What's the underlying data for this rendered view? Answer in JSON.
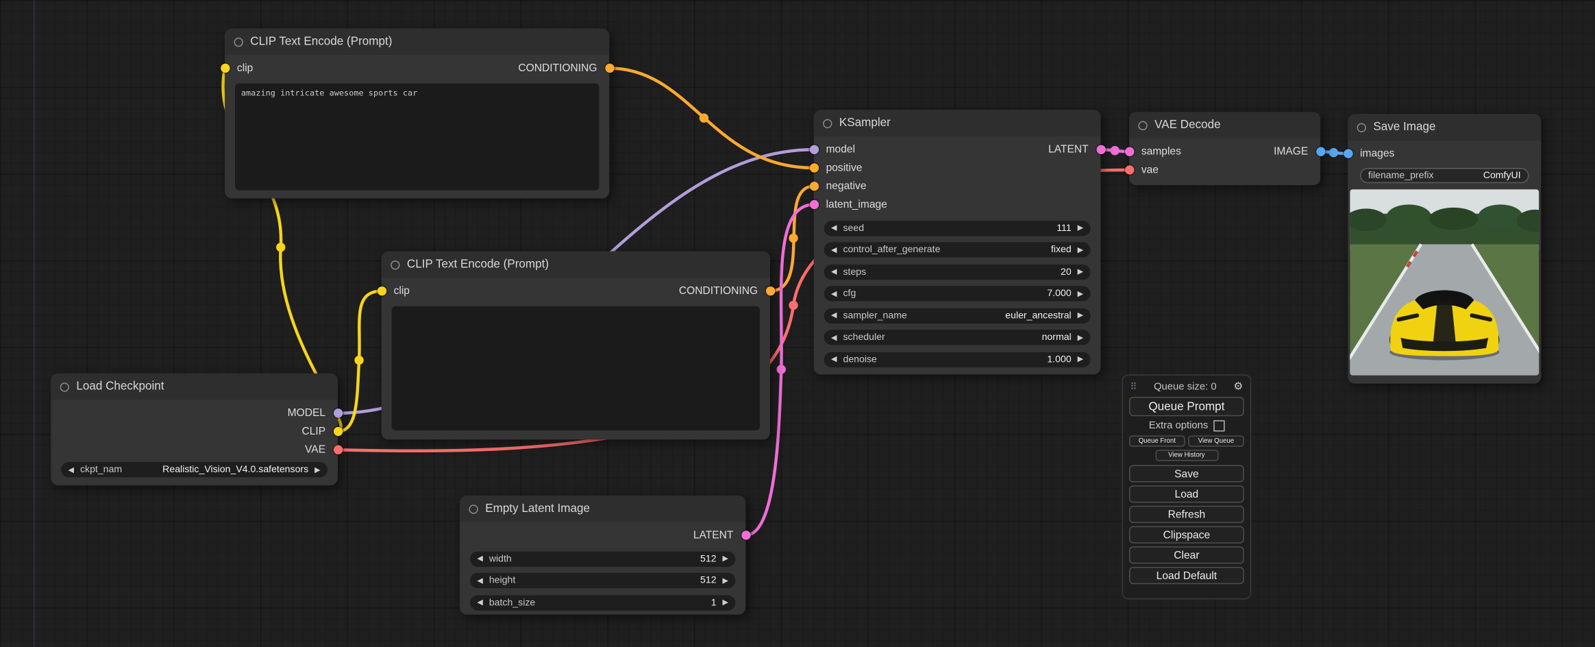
{
  "colors": {
    "clip": "#F6D51B",
    "conditioning": "#FFA931",
    "model": "#B39DDB",
    "latent": "#F06ED8",
    "vae": "#FF6E6E",
    "image": "#58A6F2"
  },
  "icons": {
    "left_arrow": "◀",
    "right_arrow": "▶",
    "gear": "⚙",
    "drag_handle": "⠿"
  },
  "nodes": {
    "clip_encode_1": {
      "title": "CLIP Text Encode (Prompt)",
      "input": "clip",
      "output": "CONDITIONING",
      "text": "amazing intricate awesome sports car"
    },
    "clip_encode_2": {
      "title": "CLIP Text Encode (Prompt)",
      "input": "clip",
      "output": "CONDITIONING",
      "text": ""
    },
    "load_checkpoint": {
      "title": "Load Checkpoint",
      "outputs": [
        "MODEL",
        "CLIP",
        "VAE"
      ],
      "widget": {
        "label": "ckpt_nam",
        "value": "Realistic_Vision_V4.0.safetensors"
      }
    },
    "empty_latent": {
      "title": "Empty Latent Image",
      "output": "LATENT",
      "widgets": [
        {
          "label": "width",
          "value": "512"
        },
        {
          "label": "height",
          "value": "512"
        },
        {
          "label": "batch_size",
          "value": "1"
        }
      ]
    },
    "ksampler": {
      "title": "KSampler",
      "inputs": [
        "model",
        "positive",
        "negative",
        "latent_image"
      ],
      "output": "LATENT",
      "widgets": [
        {
          "label": "seed",
          "value": "111"
        },
        {
          "label": "control_after_generate",
          "value": "fixed"
        },
        {
          "label": "steps",
          "value": "20"
        },
        {
          "label": "cfg",
          "value": "7.000"
        },
        {
          "label": "sampler_name",
          "value": "euler_ancestral"
        },
        {
          "label": "scheduler",
          "value": "normal"
        },
        {
          "label": "denoise",
          "value": "1.000"
        }
      ]
    },
    "vae_decode": {
      "title": "VAE Decode",
      "inputs": [
        "samples",
        "vae"
      ],
      "output": "IMAGE"
    },
    "save_image": {
      "title": "Save Image",
      "input": "images",
      "widget": {
        "label": "filename_prefix",
        "value": "ComfyUI"
      }
    }
  },
  "queue": {
    "size_label": "Queue size: 0",
    "queue_prompt": "Queue Prompt",
    "extra_options": "Extra options",
    "queue_front": "Queue Front",
    "view_queue": "View Queue",
    "view_history": "View History",
    "buttons": [
      "Save",
      "Load",
      "Refresh",
      "Clipspace",
      "Clear",
      "Load Default"
    ]
  }
}
